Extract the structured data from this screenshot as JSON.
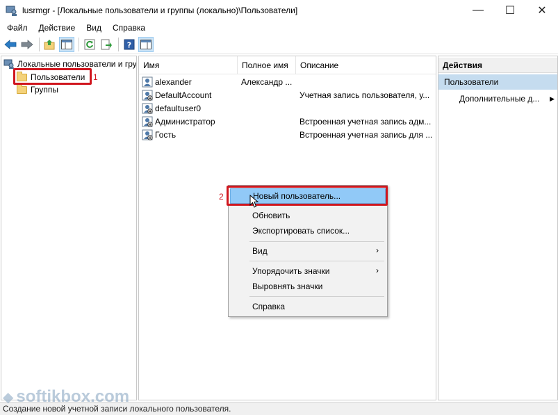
{
  "window": {
    "title": "lusrmgr - [Локальные пользователи и группы (локально)\\Пользователи]",
    "minimize": "—",
    "maximize": "☐",
    "close": "✕"
  },
  "menu": [
    "Файл",
    "Действие",
    "Вид",
    "Справка"
  ],
  "toolbar": {
    "icons": [
      "back-arrow-icon",
      "forward-arrow-icon",
      "up-folder-icon",
      "show-hide-tree-icon",
      "refresh-icon",
      "export-list-icon",
      "help-icon",
      "properties-icon"
    ]
  },
  "tree": {
    "root": "Локальные пользователи и группы (локально)",
    "items": [
      "Пользователи",
      "Группы"
    ],
    "annotation": "1"
  },
  "list": {
    "columns": [
      "Имя",
      "Полное имя",
      "Описание"
    ],
    "rows": [
      {
        "name": "alexander",
        "full_name": "Александр ...",
        "description": ""
      },
      {
        "name": "DefaultAccount",
        "full_name": "",
        "description": "Учетная запись пользователя, у..."
      },
      {
        "name": "defaultuser0",
        "full_name": "",
        "description": ""
      },
      {
        "name": "Администратор",
        "full_name": "",
        "description": "Встроенная учетная запись адм..."
      },
      {
        "name": "Гость",
        "full_name": "",
        "description": "Встроенная учетная запись для ..."
      }
    ]
  },
  "actions": {
    "header": "Действия",
    "section": "Пользователи",
    "more": "Дополнительные д...",
    "more_arrow": "▶"
  },
  "context_menu": {
    "annotation": "2",
    "items": [
      {
        "label": "Новый пользователь...",
        "highlighted": true
      },
      {
        "label": "Обновить"
      },
      {
        "label": "Экспортировать список..."
      },
      {
        "label": "Вид",
        "submenu": "›"
      },
      {
        "label": "Упорядочить значки",
        "submenu": "›"
      },
      {
        "label": "Выровнять значки"
      },
      {
        "label": "Справка"
      }
    ]
  },
  "status": "Создание новой учетной записи локального пользователя.",
  "watermark": "softikbox.com",
  "colors": {
    "highlight_red": "#d0161e",
    "menu_highlight": "#91c9f7",
    "action_section_bg": "#c5dcef"
  }
}
